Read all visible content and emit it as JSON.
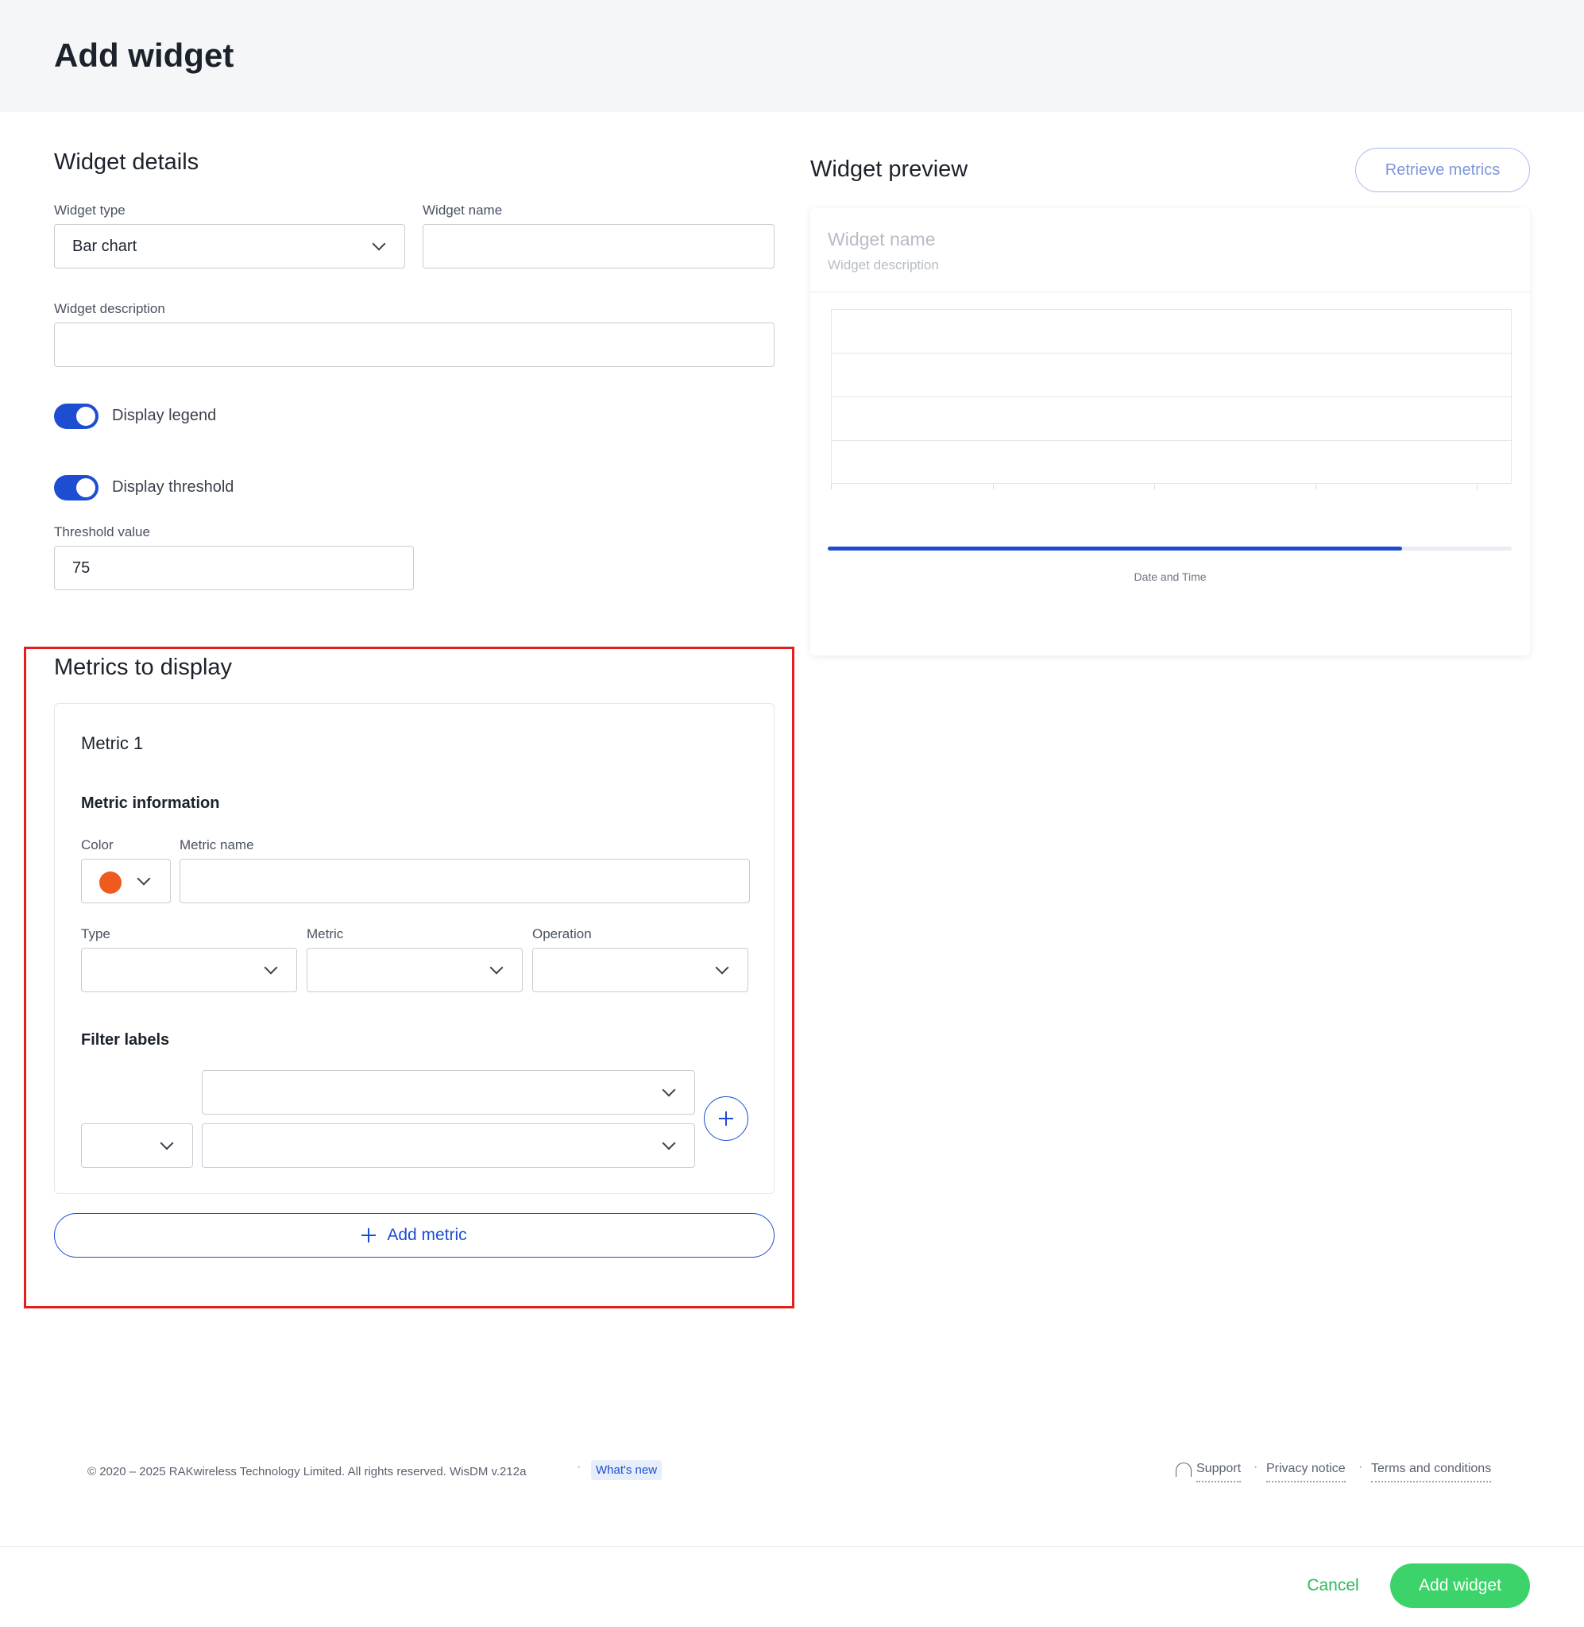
{
  "header": {
    "title": "Add widget"
  },
  "details": {
    "section_title": "Widget details",
    "widget_type": {
      "label": "Widget type",
      "value": "Bar chart"
    },
    "widget_name": {
      "label": "Widget name",
      "value": ""
    },
    "widget_description": {
      "label": "Widget description",
      "value": ""
    },
    "display_legend": {
      "label": "Display legend",
      "enabled": true
    },
    "display_threshold": {
      "label": "Display threshold",
      "enabled": true
    },
    "threshold_value": {
      "label": "Threshold value",
      "value": "75"
    }
  },
  "metrics": {
    "section_title": "Metrics to display",
    "metric_1": {
      "title": "Metric 1",
      "info_title": "Metric information",
      "color": {
        "label": "Color",
        "value": "#ef5a1f"
      },
      "metric_name": {
        "label": "Metric name",
        "value": ""
      },
      "type": {
        "label": "Type",
        "value": ""
      },
      "metric": {
        "label": "Metric",
        "value": ""
      },
      "operation": {
        "label": "Operation",
        "value": ""
      },
      "filter_labels_title": "Filter labels"
    },
    "add_metric_label": "Add metric"
  },
  "preview": {
    "section_title": "Widget preview",
    "retrieve_label": "Retrieve metrics",
    "widget_name": "Widget name",
    "widget_description": "Widget description",
    "x_axis_label": "Date and Time",
    "range_fill": 0.84
  },
  "footer": {
    "copyright": "© 2020 – 2025 RAKwireless Technology Limited. All rights reserved. WisDM v.212a",
    "whats_new": "What's new",
    "links": [
      "Support",
      "Privacy notice",
      "Terms and conditions"
    ],
    "separator": "·"
  },
  "actions": {
    "cancel": "Cancel",
    "add_widget": "Add widget"
  },
  "colors": {
    "accent": "#1d4dd1",
    "success": "#3cd46a",
    "highlight": "#e41d1d"
  }
}
